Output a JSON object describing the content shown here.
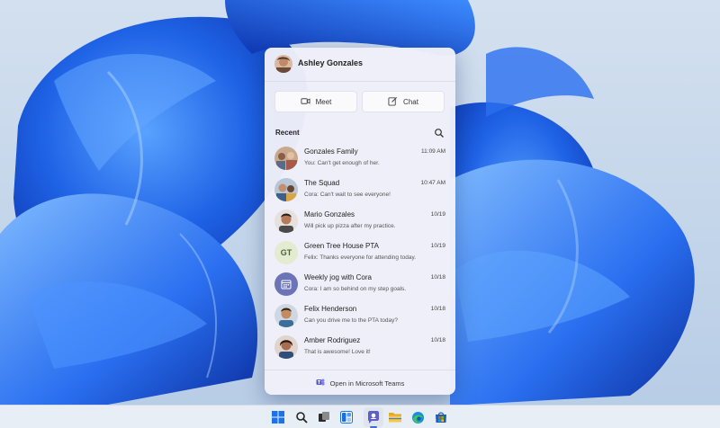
{
  "profile": {
    "name": "Ashley Gonzales"
  },
  "actions": {
    "meet_label": "Meet",
    "chat_label": "Chat"
  },
  "recent": {
    "label": "Recent",
    "items": [
      {
        "title": "Gonzales Family",
        "preview": "You: Can't get enough of her.",
        "time": "11:09 AM"
      },
      {
        "title": "The Squad",
        "preview": "Cora: Can't wait to see everyone!",
        "time": "10:47 AM"
      },
      {
        "title": "Mario Gonzales",
        "preview": "Will pick up pizza after my practice.",
        "time": "10/19"
      },
      {
        "title": "Green Tree House PTA",
        "preview": "Felix: Thanks everyone for attending today.",
        "time": "10/19",
        "initials": "GT"
      },
      {
        "title": "Weekly jog with Cora",
        "preview": "Cora: I am so behind on my step goals.",
        "time": "10/18"
      },
      {
        "title": "Felix Henderson",
        "preview": "Can you drive me to the PTA today?",
        "time": "10/18"
      },
      {
        "title": "Amber Rodriguez",
        "preview": "That is awesome! Love it!",
        "time": "10/18"
      }
    ]
  },
  "footer": {
    "open_teams_label": "Open in Microsoft Teams"
  },
  "taskbar": {
    "icons": [
      "windows-start-icon",
      "search-icon",
      "task-view-icon",
      "widgets-icon",
      "teams-chat-icon",
      "file-explorer-icon",
      "edge-browser-icon",
      "microsoft-store-icon"
    ],
    "active": "teams-chat-icon"
  },
  "colors": {
    "accent": "#3a6fd8",
    "wallpaper_bg": "#c9d9ec",
    "bloom": "#1e63e8",
    "teams_purple": "#5b5fc7"
  }
}
